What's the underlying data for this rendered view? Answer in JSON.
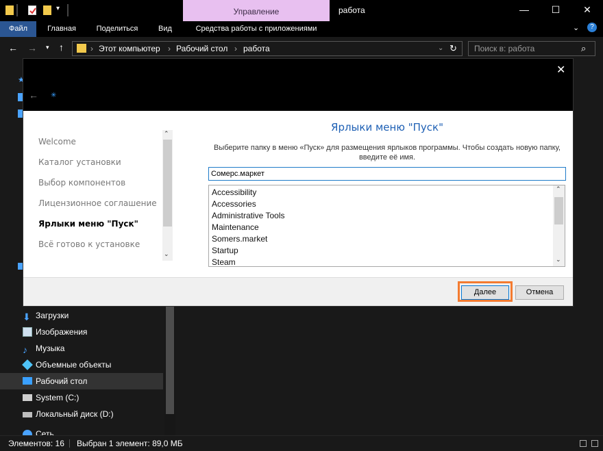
{
  "titlebar": {
    "context_tab": "Управление",
    "title": "работа"
  },
  "ribbon": {
    "tabs": [
      "Файл",
      "Главная",
      "Поделиться",
      "Вид",
      "Средства работы с приложениями"
    ]
  },
  "address": {
    "crumbs": [
      "Этот компьютер",
      "Рабочий стол",
      "работа"
    ]
  },
  "search": {
    "placeholder": "Поиск в: работа"
  },
  "nav": {
    "items": [
      "Загрузки",
      "Изображения",
      "Музыка",
      "Объемные объекты",
      "Рабочий стол",
      "System (C:)",
      "Локальный диск (D:)",
      "Сеть"
    ]
  },
  "status": {
    "count": "Элементов: 16",
    "selection": "Выбран 1 элемент: 89,0 МБ"
  },
  "installer": {
    "steps": [
      "Welcome",
      "Каталог установки",
      "Выбор компонентов",
      "Лицензионное соглашение",
      "Ярлыки меню \"Пуск\"",
      "Всё готово к установке"
    ],
    "active_step": 4,
    "heading": "Ярлыки меню \"Пуск\"",
    "description_line1": "Выберите папку в меню «Пуск» для размещения ярлыков программы. Чтобы создать новую папку,",
    "description_line2": "введите её имя.",
    "folder_value": "Сомерс.маркет",
    "folders": [
      "Accessibility",
      "Accessories",
      "Administrative Tools",
      "Maintenance",
      "Somers.market",
      "Startup",
      "Steam"
    ],
    "next_label": "Далее",
    "cancel_label": "Отмена"
  },
  "colors": {
    "accent": "#2b5693",
    "context_tab": "#e8c0f0",
    "heading": "#1d5fb4",
    "highlight_ring": "#f47b30"
  }
}
